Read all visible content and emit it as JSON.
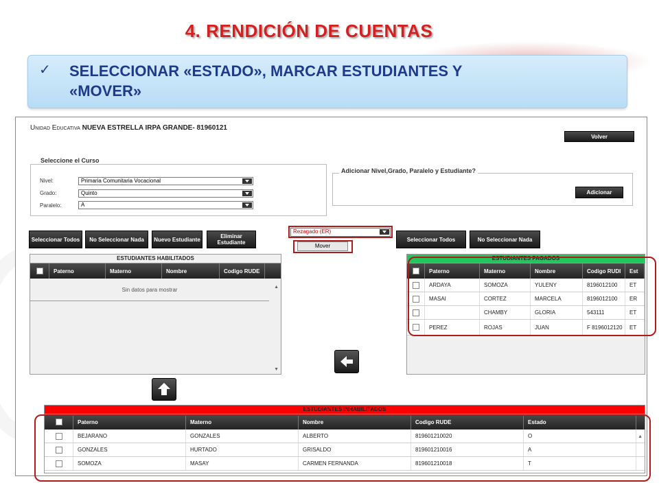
{
  "slide": {
    "title": "4. RENDICIÓN  DE CUENTAS",
    "banner_check": "✓",
    "banner_text_line1": "SELECCIONAR «ESTADO», MARCAR ESTUDIANTES Y",
    "banner_text_line2": "«MOVER»"
  },
  "app": {
    "school_prefix": "Unidad Educativa",
    "school_name": "NUEVA ESTRELLA IRPA GRANDE- 81960121",
    "volver_label": "Volver",
    "course_legend": "Seleccione el Curso",
    "nivel_label": "Nivel:",
    "nivel_value": "Primaria Comunitaria Vocacional",
    "grado_label": "Grado:",
    "grado_value": "Quinto",
    "paralelo_label": "Paralelo:",
    "paralelo_value": "A",
    "add_legend": "Adicionar Nivel,Grado, Paralelo y Estudiante?",
    "adicionar_label": "Adicionar",
    "btn_select_all": "Seleccionar Todos",
    "btn_select_none": "No Seleccionar Nada",
    "btn_new_student": "Nuevo Estudiante",
    "btn_delete_student": "Eliminar Estudiante",
    "estado_value": "Rezagado (ER)",
    "mover_label": "Mover",
    "btn_select_all_2": "Seleccionar Todos",
    "btn_select_none_2": "No Seleccionar Nada"
  },
  "habilitados": {
    "title": "ESTUDIANTES HABILITADOS",
    "columns": [
      "Paterno",
      "Materno",
      "Nombre",
      "Codigo RUDE"
    ],
    "empty_text": "Sin datos para mostrar"
  },
  "pagados": {
    "title": "ESTUDIANTES PAGADOS",
    "columns": [
      "Paterno",
      "Materno",
      "Nombre",
      "Codigo RUDI",
      "Est"
    ],
    "rows": [
      {
        "paterno": "ARDAYA",
        "materno": "SOMOZA",
        "nombre": "YULENY",
        "rude": "8196012100",
        "est": "ET"
      },
      {
        "paterno": "MASAI",
        "materno": "CORTEZ",
        "nombre": "MARCELA",
        "rude": "8196012100",
        "est": "ER"
      },
      {
        "paterno": "",
        "materno": "CHAMBY",
        "nombre": "GLORIA",
        "rude": "543111",
        "est": "ET"
      },
      {
        "paterno": "PEREZ",
        "materno": "ROJAS",
        "nombre": "JUAN",
        "rude": "F 8196012120",
        "est": "ET"
      }
    ]
  },
  "inhabilitados": {
    "title": "ESTUDIANTES INHABILITADOS",
    "columns": [
      "Paterno",
      "Materno",
      "Nombre",
      "Codigo RUDE",
      "Estado"
    ],
    "rows": [
      {
        "paterno": "BEJARANO",
        "materno": "GONZALES",
        "nombre": "ALBERTO",
        "rude": "819601210020",
        "estado": "O"
      },
      {
        "paterno": "GONZALES",
        "materno": "HURTADO",
        "nombre": "GRISALDO",
        "rude": "819601210016",
        "estado": "A"
      },
      {
        "paterno": "SOMOZA",
        "materno": "MASAY",
        "nombre": "CARMEN FERNANDA",
        "rude": "819601210018",
        "estado": "T"
      }
    ]
  },
  "colors": {
    "title_red": "#d62020",
    "banner_blue": "#c6e4f8",
    "banner_text": "#1e3a8a",
    "pagados_green": "#22c55e",
    "inhabilitados_red": "#ff0000",
    "highlight_outline": "#b11a1a"
  },
  "icons": {
    "arrow_left": "arrow-left-icon",
    "arrow_up": "arrow-up-icon"
  }
}
